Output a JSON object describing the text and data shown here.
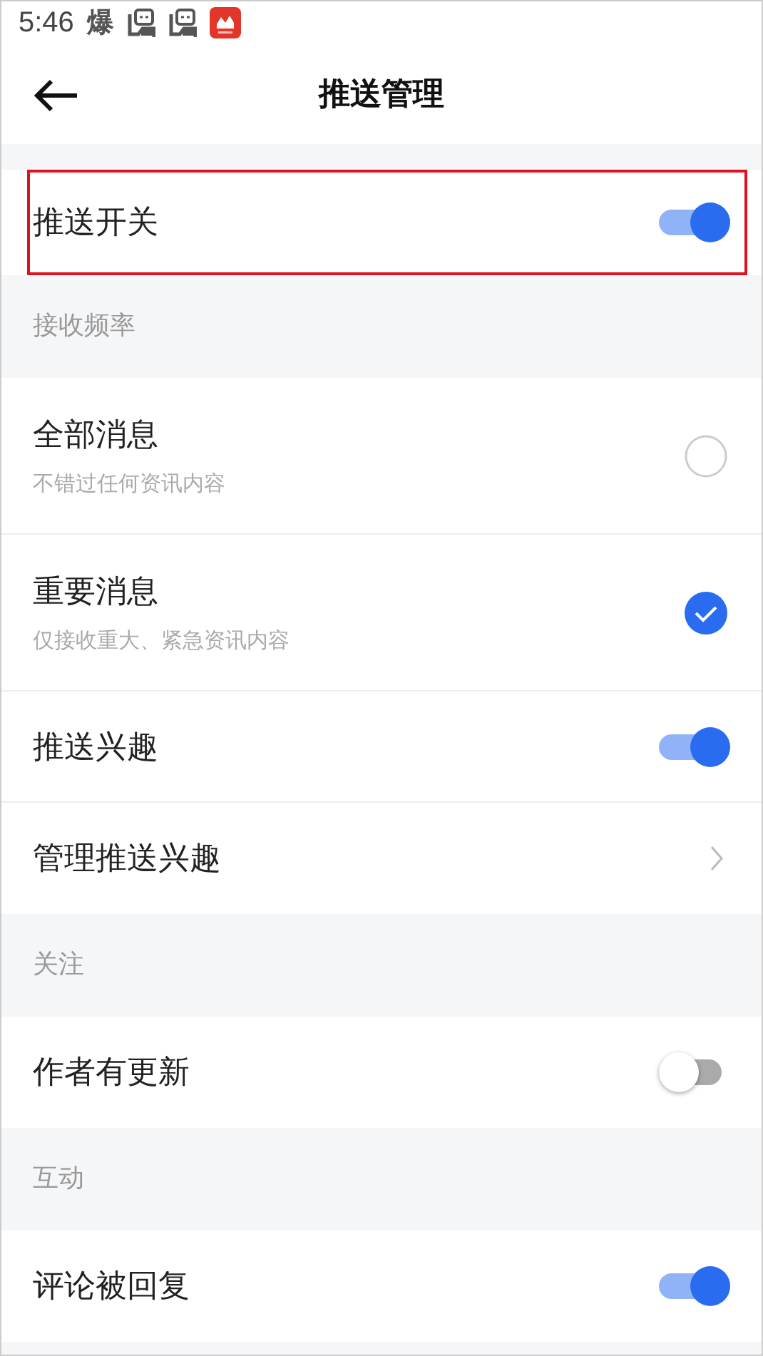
{
  "status_bar": {
    "time": "5:46",
    "notification_glyph": "爆"
  },
  "header": {
    "title": "推送管理"
  },
  "sections": [
    {
      "items": [
        {
          "kind": "toggle",
          "title": "推送开关",
          "on": true,
          "highlighted": true
        }
      ]
    },
    {
      "heading": "接收频率",
      "items": [
        {
          "kind": "radio",
          "title": "全部消息",
          "subtitle": "不错过任何资讯内容",
          "selected": false
        },
        {
          "kind": "radio",
          "title": "重要消息",
          "subtitle": "仅接收重大、紧急资讯内容",
          "selected": true
        },
        {
          "kind": "toggle",
          "title": "推送兴趣",
          "on": true
        },
        {
          "kind": "link",
          "title": "管理推送兴趣"
        }
      ]
    },
    {
      "heading": "关注",
      "items": [
        {
          "kind": "toggle",
          "title": "作者有更新",
          "on": false
        }
      ]
    },
    {
      "heading": "互动",
      "items": [
        {
          "kind": "toggle",
          "title": "评论被回复",
          "on": true
        }
      ]
    }
  ]
}
